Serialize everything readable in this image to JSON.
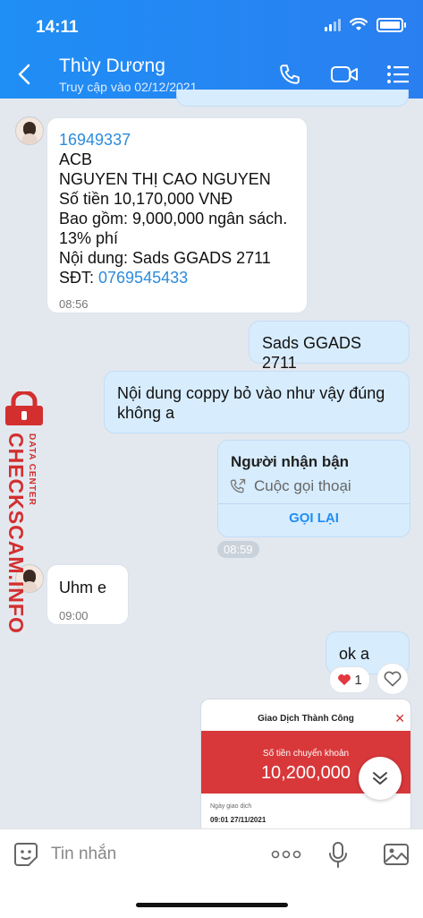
{
  "status": {
    "time": "14:11"
  },
  "header": {
    "name": "Thùy Dương",
    "subtitle": "Truy cập vào 02/12/2021",
    "icons": [
      "back-icon",
      "phone-icon",
      "video-icon",
      "menu-icon"
    ]
  },
  "messages": {
    "m1": {
      "lines": [
        "16949337",
        "ACB",
        "NGUYEN THỊ CAO NGUYEN",
        "Số tiền 10,170,000 VNĐ",
        "Bao gồm: 9,000,000 ngân sách.",
        "13% phí",
        "Nội dung: Sads GGADS 2711"
      ],
      "phone_label": "SĐT: ",
      "phone": "0769545433",
      "time": "08:56"
    },
    "m2": {
      "text": "Sads GGADS 2711"
    },
    "m3": {
      "lines": [
        "Nội dung coppy bỏ vào như vậy đúng",
        "không a"
      ]
    },
    "call": {
      "title": "Người nhận bận",
      "subtitle": "Cuộc gọi thoại",
      "action": "GỌI LẠI",
      "time": "08:59"
    },
    "m4": {
      "text": "Uhm e",
      "time": "09:00"
    },
    "m5": {
      "text": "ok a",
      "reaction_count": "1"
    },
    "receipt": {
      "title": "Giao Dịch Thành Công",
      "amount_label": "Số tiền chuyển khoản",
      "amount": "10,200,000",
      "date_label": "Ngày giao dịch",
      "date": "09:01 27/11/2021"
    }
  },
  "watermark": {
    "brand": "CHECKSCAM.INFO",
    "sub": "DATA CENTER"
  },
  "composer": {
    "placeholder": "Tin nhắn"
  },
  "colors": {
    "header": "#1f8ef5",
    "outgoing": "#d7ecfd",
    "incoming": "#ffffff",
    "watermark": "#d32f2f",
    "receipt_band": "#d8383a"
  }
}
